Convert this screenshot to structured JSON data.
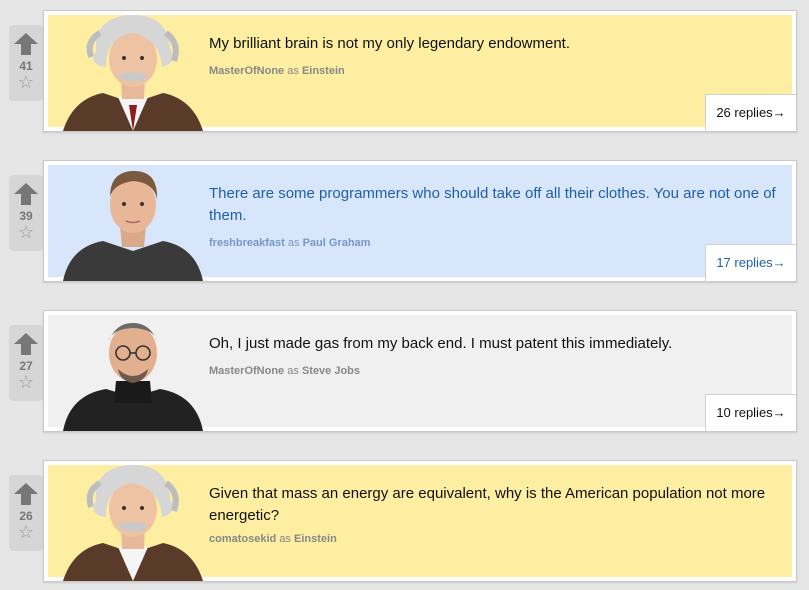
{
  "posts": [
    {
      "votes": "41",
      "quote": "My brilliant brain is not my only legendary endowment.",
      "user": "MasterOfNone",
      "as": "as",
      "character": "Einstein",
      "replies": "26 replies→",
      "theme": "#fdeea2"
    },
    {
      "votes": "39",
      "quote": "There are some programmers who should take off all their clothes. You are not one of them.",
      "user": "freshbreakfast",
      "as": "as",
      "character": "Paul Graham",
      "replies": "17 replies→",
      "theme": "#d7e6fb"
    },
    {
      "votes": "27",
      "quote": "Oh, I just made gas from my back end. I must patent this immediately.",
      "user": "MasterOfNone",
      "as": "as",
      "character": "Steve Jobs",
      "replies": "10 replies→",
      "theme": "#f0f0f0"
    },
    {
      "votes": "26",
      "quote": "Given that mass an energy are equivalent, why is the American population not more energetic?",
      "user": "comatosekid",
      "as": "as",
      "character": "Einstein",
      "replies": "",
      "theme": "#fdeea2"
    }
  ],
  "icons": {
    "upvote": "up-arrow-icon",
    "favorite": "star-icon"
  }
}
